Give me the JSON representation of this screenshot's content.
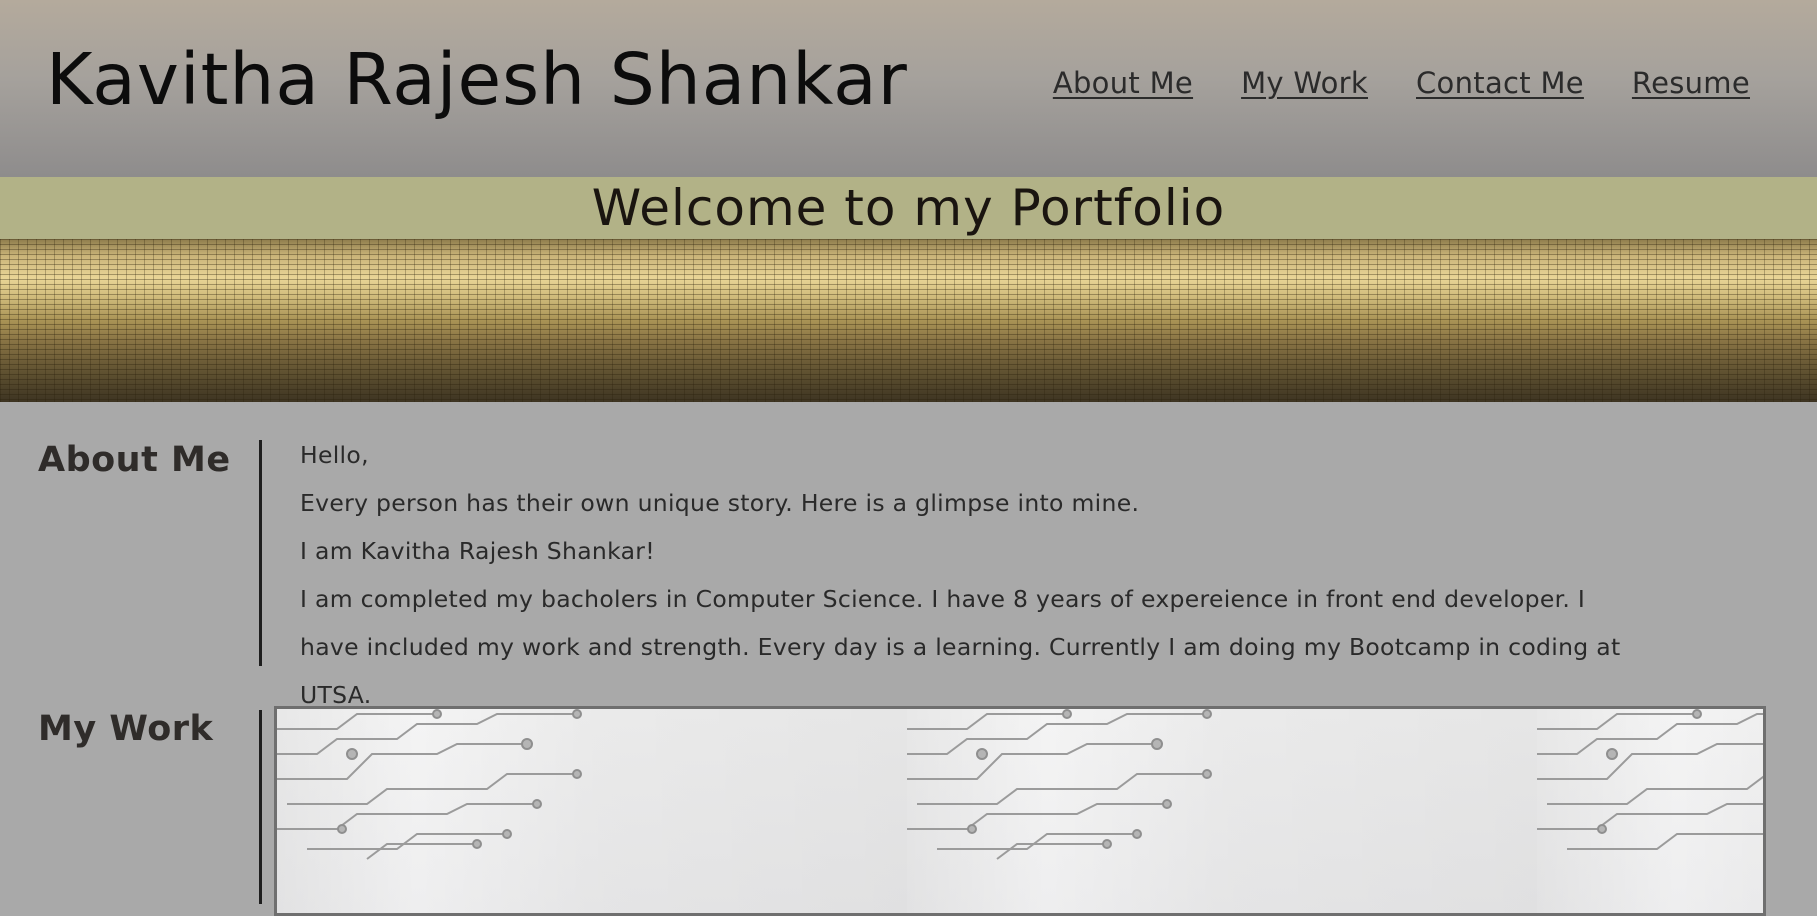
{
  "header": {
    "title": "Kavitha Rajesh Shankar",
    "nav": [
      {
        "label": "About Me"
      },
      {
        "label": "My Work"
      },
      {
        "label": "Contact Me"
      },
      {
        "label": "Resume"
      }
    ]
  },
  "banner": {
    "title": "Welcome to my Portfolio"
  },
  "about": {
    "heading": "About Me",
    "lines": [
      "Hello,",
      "Every person has their own unique story. Here is a glimpse into mine.",
      "I am Kavitha Rajesh Shankar!",
      "I am completed my bacholers in Computer Science. I have 8 years of expereience in front end developer. I have included my work and strength. Every day is a learning. Currently I am doing my Bootcamp in coding at UTSA."
    ]
  },
  "work": {
    "heading": "My Work"
  },
  "colors": {
    "header_top": "#b4aa9c",
    "header_bottom": "#8e8c8c",
    "banner_band": "#b2b287",
    "page_background": "#a9a9a9",
    "text_dark": "#2f2c2a"
  }
}
